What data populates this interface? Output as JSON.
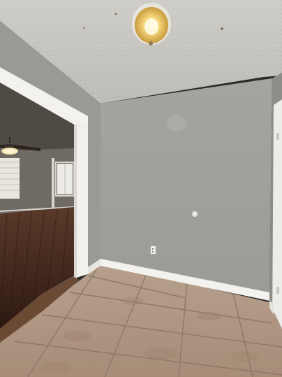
{
  "scene": {
    "subject": "empty-room-interior",
    "elements": [
      "textured-ceiling",
      "ceiling-light-fixture",
      "gray-walls",
      "open-doorway",
      "adjacent-room-with-ceiling-fan",
      "window-with-blinds",
      "hardwood-floor",
      "beige-tile-floor",
      "white-baseboards",
      "electrical-outlet",
      "thermostat-sensor",
      "white-door-frame-right"
    ],
    "colors": {
      "ceiling": "#d9d8d4",
      "wall": "#a9a8a3",
      "wall_left": "#9a9893",
      "tile": "#b9a08b",
      "grout": "#8f7a68",
      "trim": "#f2f1ed",
      "hardwood": "#3b2219",
      "light_glow": "#f6d77a"
    }
  }
}
